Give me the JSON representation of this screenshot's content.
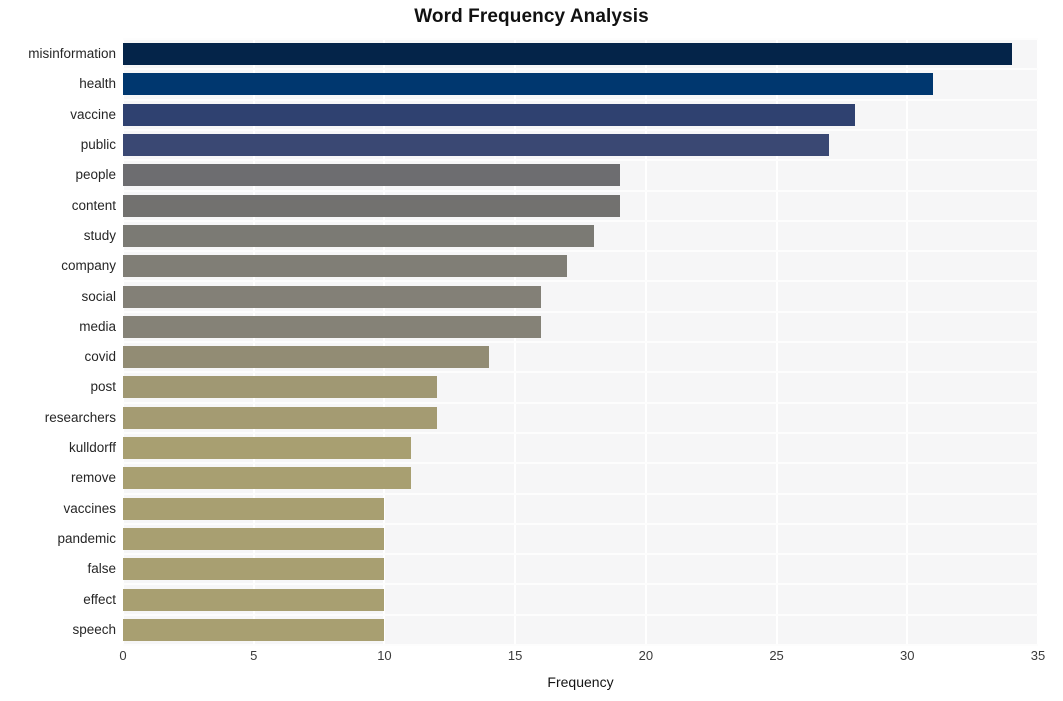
{
  "chart_data": {
    "type": "bar",
    "orientation": "horizontal",
    "title": "Word Frequency Analysis",
    "xlabel": "Frequency",
    "ylabel": "",
    "xlim": [
      0,
      35
    ],
    "ylim": null,
    "grid": true,
    "legend": null,
    "xticks": [
      0,
      5,
      10,
      15,
      20,
      25,
      30,
      35
    ],
    "xtick_labels": [
      "0",
      "5",
      "10",
      "15",
      "20",
      "25",
      "30",
      "35"
    ],
    "categories": [
      "misinformation",
      "health",
      "vaccine",
      "public",
      "people",
      "content",
      "study",
      "company",
      "social",
      "media",
      "covid",
      "post",
      "researchers",
      "kulldorff",
      "remove",
      "vaccines",
      "pandemic",
      "false",
      "effect",
      "speech"
    ],
    "values": [
      34,
      31,
      28,
      27,
      19,
      19,
      18,
      17,
      16,
      16,
      14,
      12,
      12,
      11,
      11,
      10,
      10,
      10,
      10,
      10
    ],
    "bar_colors": [
      "#042449",
      "#00376f",
      "#2f4170",
      "#3a4873",
      "#6d6d70",
      "#72716f",
      "#7b7a74",
      "#807e76",
      "#838077",
      "#858277",
      "#928c74",
      "#a09873",
      "#a49b72",
      "#a89f71",
      "#a89f71",
      "#a89f71",
      "#a89f71",
      "#a89f71",
      "#a89f71",
      "#a89f71"
    ],
    "plot_background": "#f6f6f7",
    "figure_background": "#ffffff",
    "gridline_color": "#ffffff"
  }
}
